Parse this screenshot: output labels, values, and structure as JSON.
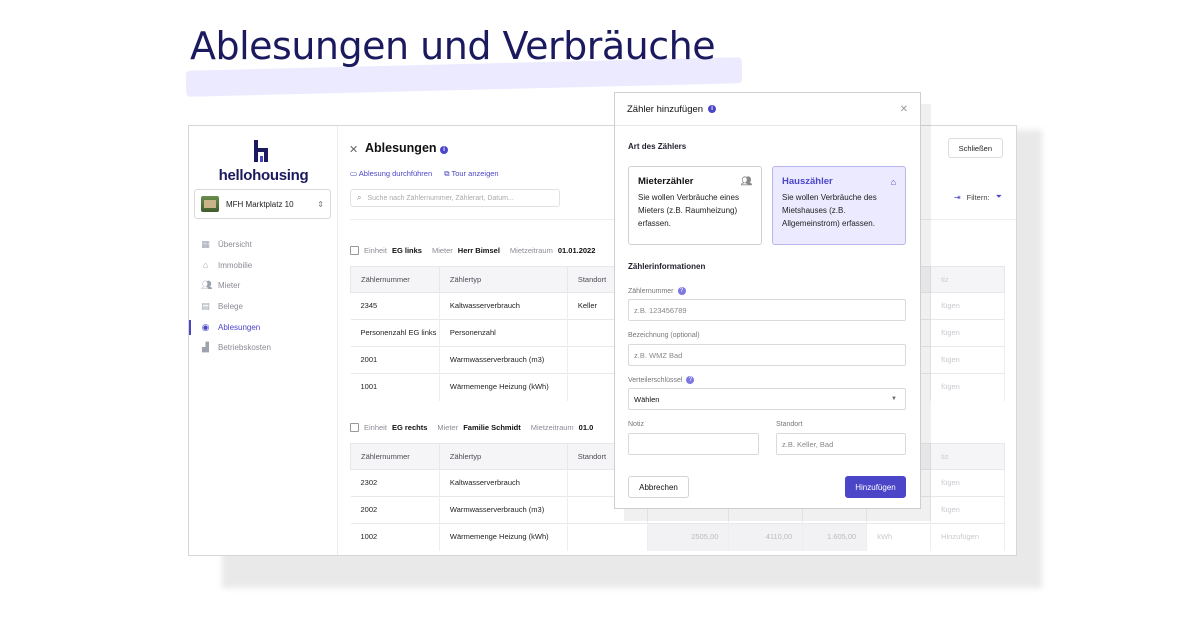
{
  "headline": "Ablesungen und Verbräuche",
  "brand": {
    "logo_text": "hellohousing"
  },
  "property_select": {
    "value": "MFH Marktplatz 10"
  },
  "sidebar": {
    "items": [
      {
        "label": "Übersicht",
        "icon": "grid-icon"
      },
      {
        "label": "Immobilie",
        "icon": "home-icon"
      },
      {
        "label": "Mieter",
        "icon": "users-icon"
      },
      {
        "label": "Belege",
        "icon": "document-icon"
      },
      {
        "label": "Ablesungen",
        "icon": "meter-icon",
        "active": true
      },
      {
        "label": "Betriebskosten",
        "icon": "cost-icon"
      }
    ]
  },
  "main": {
    "title": "Ablesungen",
    "link_reading": "Ablesung durchführen",
    "link_tour": "Tour anzeigen",
    "search_placeholder": "Suche nach Zählernummer, Zählerart, Datum...",
    "close_button": "Schließen",
    "filter_label": "Filtern:"
  },
  "units": [
    {
      "einheit_label": "Einheit",
      "einheit": "EG links",
      "mieter_label": "Mieter",
      "mieter": "Herr Bimsel",
      "zeitraum_label": "Mietzeitraum",
      "zeitraum": "01.01.2022",
      "headers": [
        "Zählernummer",
        "Zählertyp",
        "Standort",
        "",
        "",
        "",
        "",
        "tiz"
      ],
      "rows": [
        {
          "nummer": "2345",
          "typ": "Kaltwasserverbrauch",
          "standort": "Keller",
          "action": "fügen"
        },
        {
          "nummer": "Personenzahl EG links",
          "typ": "Personenzahl",
          "standort": "",
          "action": "fügen"
        },
        {
          "nummer": "2001",
          "typ": "Warmwasserverbrauch (m3)",
          "standort": "",
          "action": "fügen"
        },
        {
          "nummer": "1001",
          "typ": "Wärmemenge Heizung (kWh)",
          "standort": "",
          "action": "fügen"
        }
      ]
    },
    {
      "einheit_label": "Einheit",
      "einheit": "EG rechts",
      "mieter_label": "Mieter",
      "mieter": "Familie Schmidt",
      "zeitraum_label": "Mietzeitraum",
      "zeitraum": "01.0",
      "headers": [
        "Zählernummer",
        "Zählertyp",
        "Standort",
        "",
        "",
        "",
        "",
        "tiz"
      ],
      "rows": [
        {
          "nummer": "2302",
          "typ": "Kaltwasserverbrauch",
          "standort": "",
          "action": "fügen"
        },
        {
          "nummer": "2002",
          "typ": "Warmwasserverbrauch (m3)",
          "standort": "",
          "action": "fügen"
        },
        {
          "nummer": "1002",
          "typ": "Wärmemenge Heizung (kWh)",
          "standort": "",
          "v1": "2505,00",
          "v2": "4110,00",
          "v3": "1.605,00",
          "unit": "kWh",
          "action": "Hinzufügen"
        }
      ]
    }
  ],
  "modal": {
    "title": "Zähler hinzufügen",
    "section_type": "Art des Zählers",
    "card_tenant": {
      "title": "Mieterzähler",
      "desc": "Sie wollen Verbräuche eines Mieters (z.B. Raumheizung) erfassen."
    },
    "card_house": {
      "title": "Hauszähler",
      "desc": "Sie wollen Verbräuche des Mietshauses (z.B. Allgemeinstrom) erfassen."
    },
    "section_info": "Zählerinformationen",
    "label_number": "Zählernummer",
    "placeholder_number": "z.B. 123456789",
    "label_name": "Bezeichnung (optional)",
    "placeholder_name": "z.B. WMZ Bad",
    "label_key": "Verteilerschlüssel",
    "select_key": "Wählen",
    "label_note": "Notiz",
    "label_location": "Standort",
    "placeholder_location": "z.B. Keller, Bad",
    "cancel": "Abbrechen",
    "submit": "Hinzufügen"
  },
  "colors": {
    "accent": "#4b46c8",
    "headline": "#1c1a5e",
    "selected_card": "#ebeaff"
  }
}
